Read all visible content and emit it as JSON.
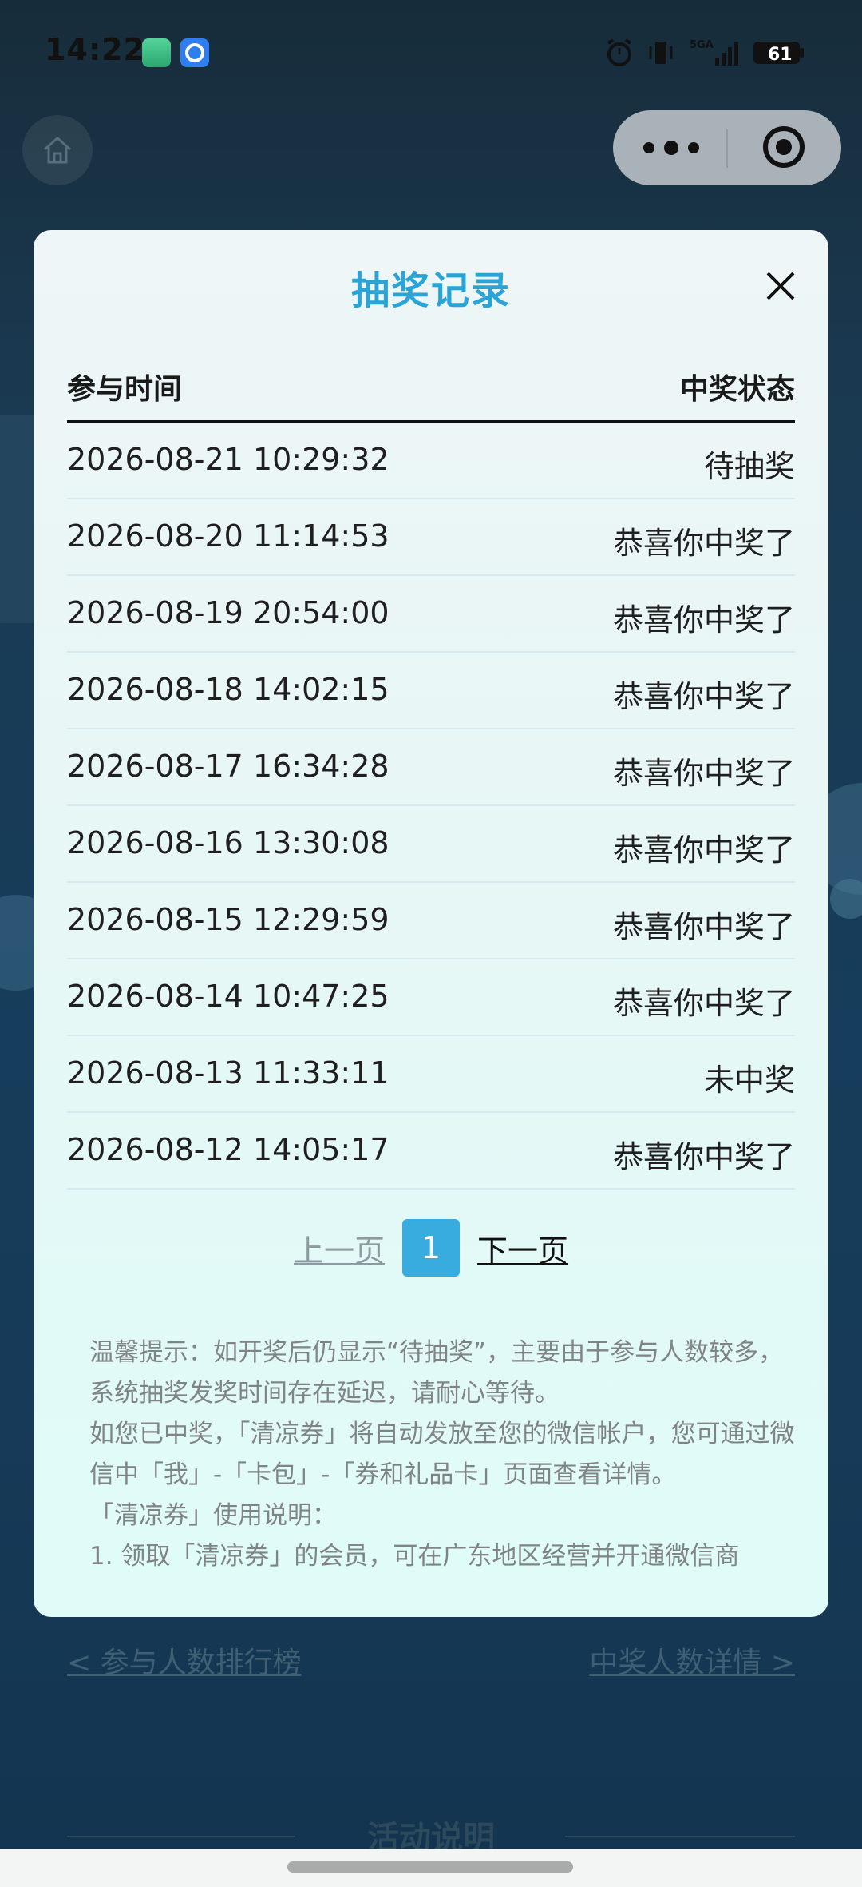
{
  "statusbar": {
    "time": "14:22",
    "network": "5GA",
    "battery": "61"
  },
  "modal": {
    "title": "抽奖记录",
    "table": {
      "headers": [
        "参与时间",
        "中奖状态"
      ],
      "rows": [
        {
          "time": "2026-08-21 10:29:32",
          "status": "待抽奖"
        },
        {
          "time": "2026-08-20 11:14:53",
          "status": "恭喜你中奖了"
        },
        {
          "time": "2026-08-19 20:54:00",
          "status": "恭喜你中奖了"
        },
        {
          "time": "2026-08-18 14:02:15",
          "status": "恭喜你中奖了"
        },
        {
          "time": "2026-08-17 16:34:28",
          "status": "恭喜你中奖了"
        },
        {
          "time": "2026-08-16 13:30:08",
          "status": "恭喜你中奖了"
        },
        {
          "time": "2026-08-15 12:29:59",
          "status": "恭喜你中奖了"
        },
        {
          "time": "2026-08-14 10:47:25",
          "status": "恭喜你中奖了"
        },
        {
          "time": "2026-08-13 11:33:11",
          "status": "未中奖"
        },
        {
          "time": "2026-08-12 14:05:17",
          "status": "恭喜你中奖了"
        }
      ]
    },
    "pager": {
      "prev": "上一页",
      "current": "1",
      "next": "下一页"
    },
    "notes": [
      "温馨提示：如开奖后仍显示“待抽奖”，主要由于参与人数较多，系统抽奖发奖时间存在延迟，请耐心等待。",
      "如您已中奖，「清凉券」将自动发放至您的微信帐户，您可通过微信中「我」-「卡包」-「券和礼品卡」页面查看详情。",
      "「清凉券」使用说明：",
      "1. 领取「清凉券」的会员，可在广东地区经营并开通微信商"
    ]
  },
  "links": {
    "ranking": "< 参与人数排行榜",
    "winners": "中奖人数详情 >"
  },
  "section": {
    "title": "活动说明"
  },
  "colors": {
    "accent": "#2aa4d6",
    "page_active": "#38acdf",
    "modal_bg": "#e6f7f6"
  }
}
